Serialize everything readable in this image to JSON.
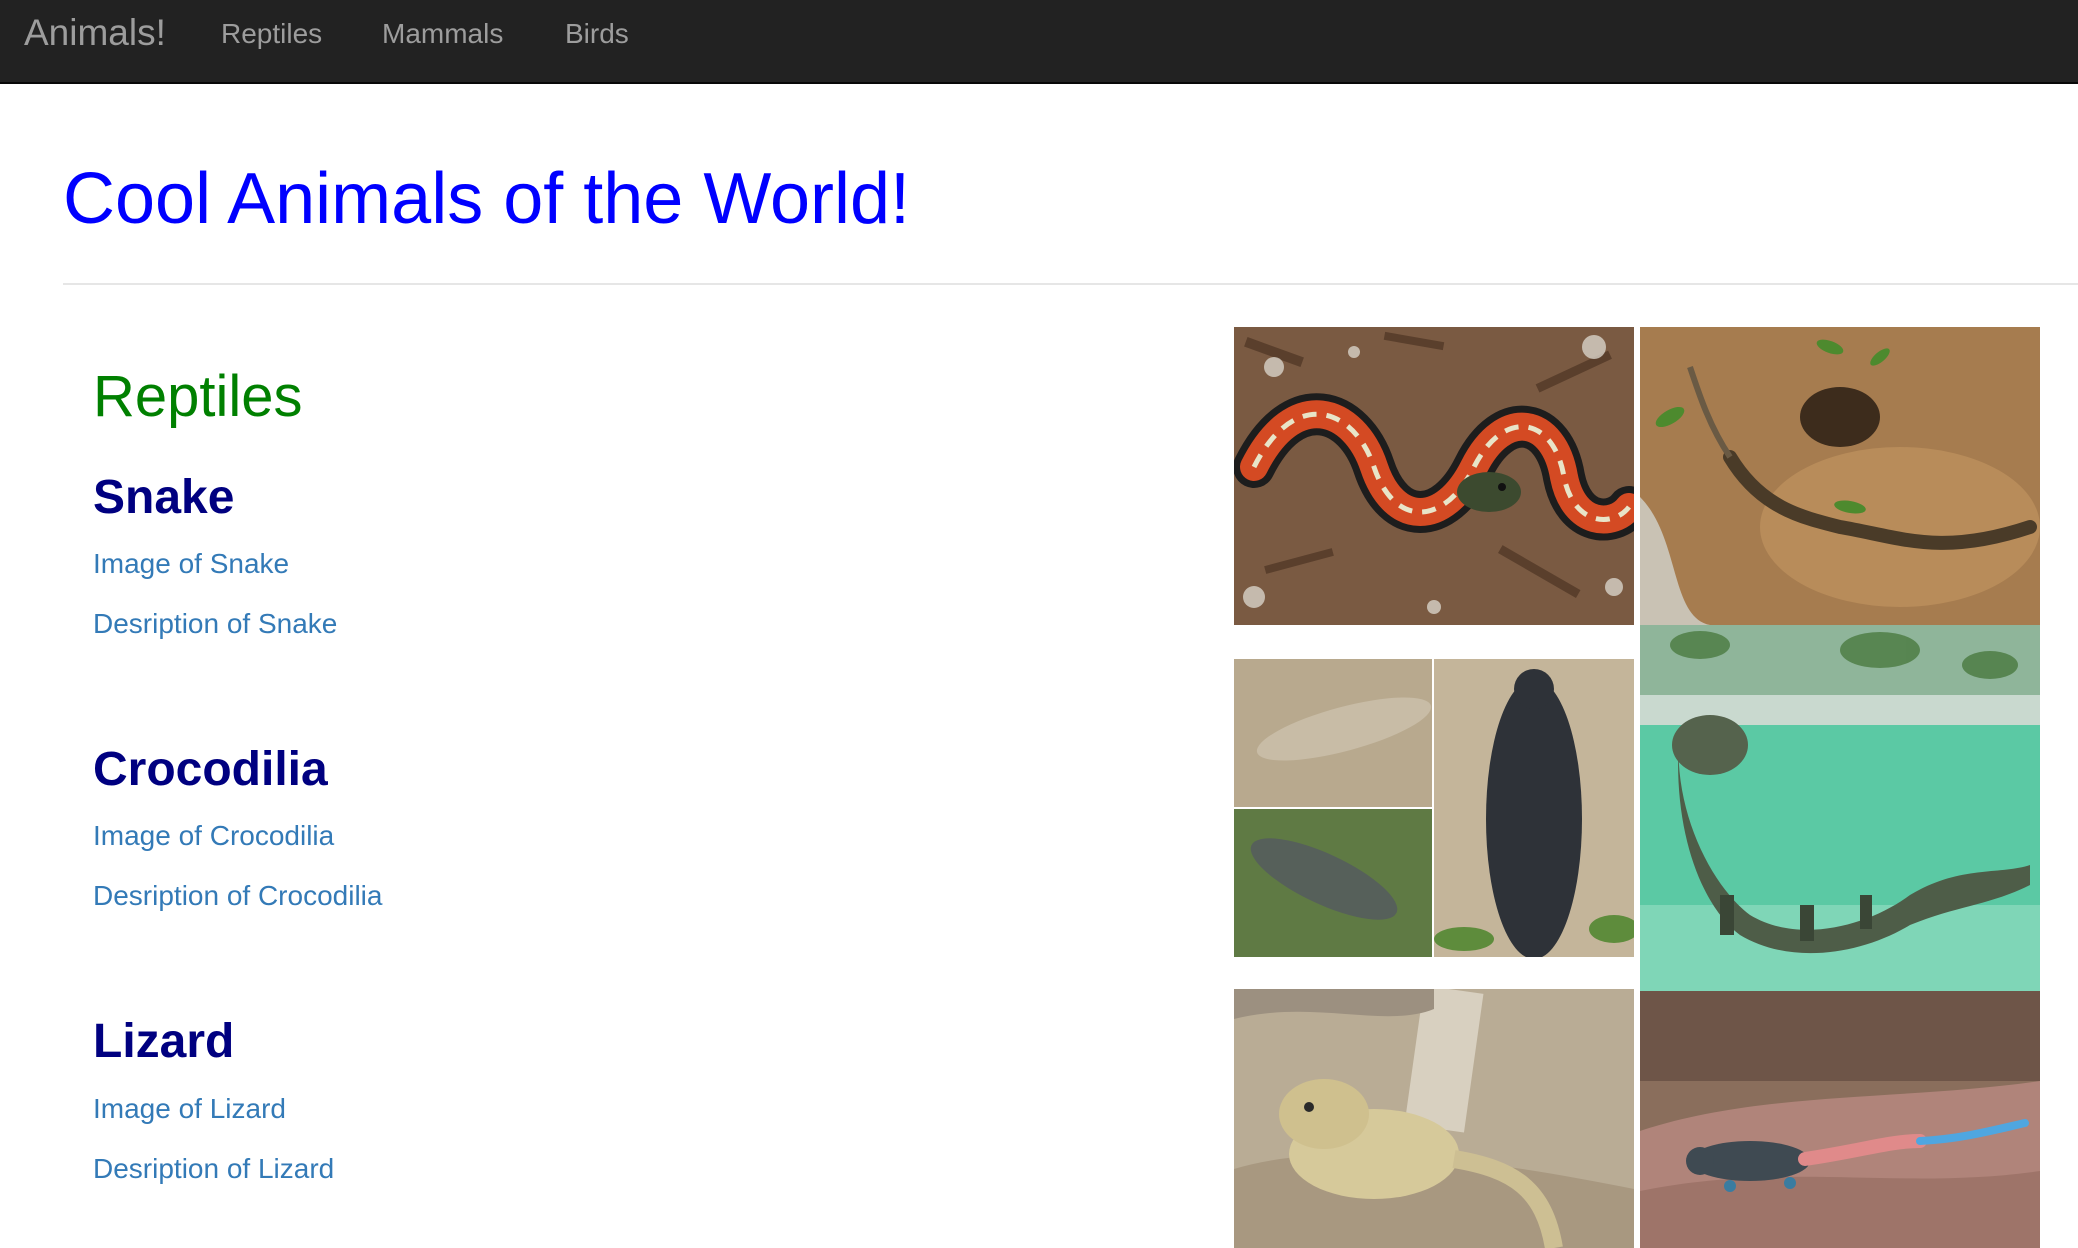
{
  "navbar": {
    "brand": "Animals!",
    "links": [
      "Reptiles",
      "Mammals",
      "Birds"
    ]
  },
  "page": {
    "title": "Cool Animals of the World!"
  },
  "section": {
    "title": "Reptiles",
    "animals": [
      {
        "name": "Snake",
        "image_link": "Image of Snake",
        "description_link": "Desription of Snake"
      },
      {
        "name": "Crocodilia",
        "image_link": "Image of Crocodilia",
        "description_link": "Desription of Crocodilia"
      },
      {
        "name": "Lizard",
        "image_link": "Image of Lizard",
        "description_link": "Desription of Lizard"
      }
    ]
  },
  "colors": {
    "navbar_bg": "#222222",
    "nav_text": "#9d9d9d",
    "title": "#0000ff",
    "section_title": "#008000",
    "animal_name": "#000080",
    "link": "#337ab7"
  }
}
